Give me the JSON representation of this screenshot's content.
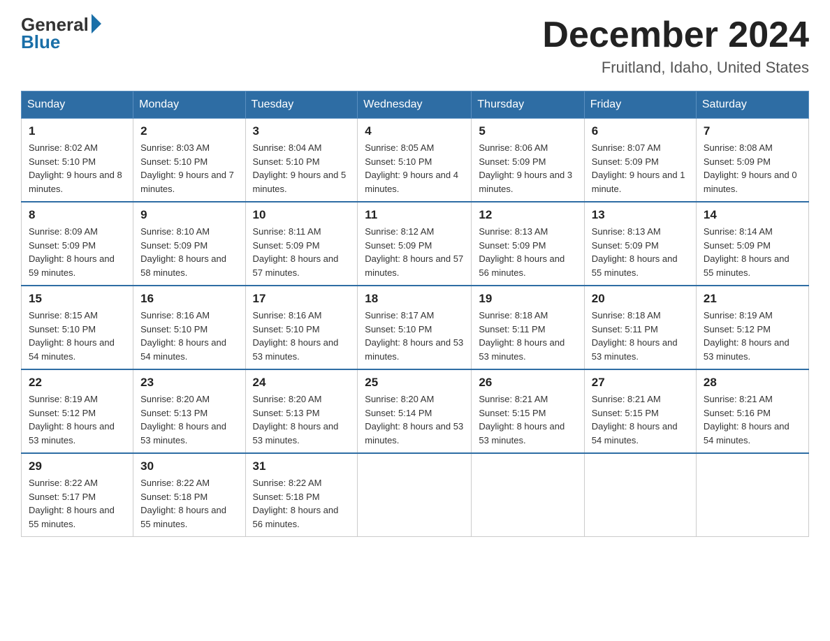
{
  "header": {
    "logo_general": "General",
    "logo_blue": "Blue",
    "month_title": "December 2024",
    "location": "Fruitland, Idaho, United States"
  },
  "days_of_week": [
    "Sunday",
    "Monday",
    "Tuesday",
    "Wednesday",
    "Thursday",
    "Friday",
    "Saturday"
  ],
  "weeks": [
    [
      {
        "day": "1",
        "sunrise": "8:02 AM",
        "sunset": "5:10 PM",
        "daylight": "9 hours and 8 minutes."
      },
      {
        "day": "2",
        "sunrise": "8:03 AM",
        "sunset": "5:10 PM",
        "daylight": "9 hours and 7 minutes."
      },
      {
        "day": "3",
        "sunrise": "8:04 AM",
        "sunset": "5:10 PM",
        "daylight": "9 hours and 5 minutes."
      },
      {
        "day": "4",
        "sunrise": "8:05 AM",
        "sunset": "5:10 PM",
        "daylight": "9 hours and 4 minutes."
      },
      {
        "day": "5",
        "sunrise": "8:06 AM",
        "sunset": "5:09 PM",
        "daylight": "9 hours and 3 minutes."
      },
      {
        "day": "6",
        "sunrise": "8:07 AM",
        "sunset": "5:09 PM",
        "daylight": "9 hours and 1 minute."
      },
      {
        "day": "7",
        "sunrise": "8:08 AM",
        "sunset": "5:09 PM",
        "daylight": "9 hours and 0 minutes."
      }
    ],
    [
      {
        "day": "8",
        "sunrise": "8:09 AM",
        "sunset": "5:09 PM",
        "daylight": "8 hours and 59 minutes."
      },
      {
        "day": "9",
        "sunrise": "8:10 AM",
        "sunset": "5:09 PM",
        "daylight": "8 hours and 58 minutes."
      },
      {
        "day": "10",
        "sunrise": "8:11 AM",
        "sunset": "5:09 PM",
        "daylight": "8 hours and 57 minutes."
      },
      {
        "day": "11",
        "sunrise": "8:12 AM",
        "sunset": "5:09 PM",
        "daylight": "8 hours and 57 minutes."
      },
      {
        "day": "12",
        "sunrise": "8:13 AM",
        "sunset": "5:09 PM",
        "daylight": "8 hours and 56 minutes."
      },
      {
        "day": "13",
        "sunrise": "8:13 AM",
        "sunset": "5:09 PM",
        "daylight": "8 hours and 55 minutes."
      },
      {
        "day": "14",
        "sunrise": "8:14 AM",
        "sunset": "5:09 PM",
        "daylight": "8 hours and 55 minutes."
      }
    ],
    [
      {
        "day": "15",
        "sunrise": "8:15 AM",
        "sunset": "5:10 PM",
        "daylight": "8 hours and 54 minutes."
      },
      {
        "day": "16",
        "sunrise": "8:16 AM",
        "sunset": "5:10 PM",
        "daylight": "8 hours and 54 minutes."
      },
      {
        "day": "17",
        "sunrise": "8:16 AM",
        "sunset": "5:10 PM",
        "daylight": "8 hours and 53 minutes."
      },
      {
        "day": "18",
        "sunrise": "8:17 AM",
        "sunset": "5:10 PM",
        "daylight": "8 hours and 53 minutes."
      },
      {
        "day": "19",
        "sunrise": "8:18 AM",
        "sunset": "5:11 PM",
        "daylight": "8 hours and 53 minutes."
      },
      {
        "day": "20",
        "sunrise": "8:18 AM",
        "sunset": "5:11 PM",
        "daylight": "8 hours and 53 minutes."
      },
      {
        "day": "21",
        "sunrise": "8:19 AM",
        "sunset": "5:12 PM",
        "daylight": "8 hours and 53 minutes."
      }
    ],
    [
      {
        "day": "22",
        "sunrise": "8:19 AM",
        "sunset": "5:12 PM",
        "daylight": "8 hours and 53 minutes."
      },
      {
        "day": "23",
        "sunrise": "8:20 AM",
        "sunset": "5:13 PM",
        "daylight": "8 hours and 53 minutes."
      },
      {
        "day": "24",
        "sunrise": "8:20 AM",
        "sunset": "5:13 PM",
        "daylight": "8 hours and 53 minutes."
      },
      {
        "day": "25",
        "sunrise": "8:20 AM",
        "sunset": "5:14 PM",
        "daylight": "8 hours and 53 minutes."
      },
      {
        "day": "26",
        "sunrise": "8:21 AM",
        "sunset": "5:15 PM",
        "daylight": "8 hours and 53 minutes."
      },
      {
        "day": "27",
        "sunrise": "8:21 AM",
        "sunset": "5:15 PM",
        "daylight": "8 hours and 54 minutes."
      },
      {
        "day": "28",
        "sunrise": "8:21 AM",
        "sunset": "5:16 PM",
        "daylight": "8 hours and 54 minutes."
      }
    ],
    [
      {
        "day": "29",
        "sunrise": "8:22 AM",
        "sunset": "5:17 PM",
        "daylight": "8 hours and 55 minutes."
      },
      {
        "day": "30",
        "sunrise": "8:22 AM",
        "sunset": "5:18 PM",
        "daylight": "8 hours and 55 minutes."
      },
      {
        "day": "31",
        "sunrise": "8:22 AM",
        "sunset": "5:18 PM",
        "daylight": "8 hours and 56 minutes."
      },
      null,
      null,
      null,
      null
    ]
  ],
  "labels": {
    "sunrise": "Sunrise:",
    "sunset": "Sunset:",
    "daylight": "Daylight:"
  }
}
